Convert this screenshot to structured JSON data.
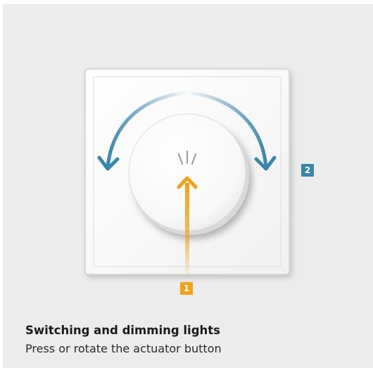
{
  "illustration": {
    "markers": [
      {
        "number": "1",
        "color": "#f2a21b",
        "meaning": "press"
      },
      {
        "number": "2",
        "color": "#3a86ad",
        "meaning": "rotate"
      }
    ],
    "icons": [
      "rotation-arrows-icon",
      "press-arrow-icon"
    ]
  },
  "caption": {
    "title": "Switching and dimming lights",
    "subtitle": "Press or rotate the actuator button"
  },
  "colors": {
    "background": "#ececec",
    "press_accent": "#f2a21b",
    "rotate_accent": "#3a86ad"
  }
}
